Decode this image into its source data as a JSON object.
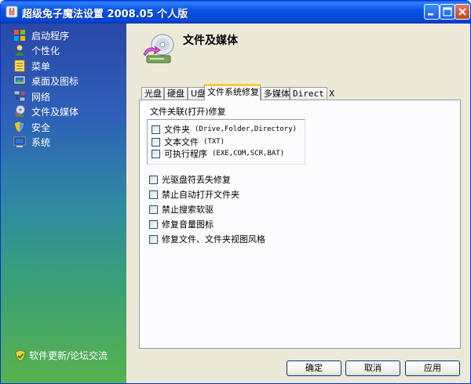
{
  "window": {
    "title": "超级兔子魔法设置 2008.05 个人版"
  },
  "sidebar": {
    "items": [
      {
        "label": "启动程序",
        "icon": "startup-icon"
      },
      {
        "label": "个性化",
        "icon": "personalize-icon"
      },
      {
        "label": "菜单",
        "icon": "menu-icon"
      },
      {
        "label": "桌面及图标",
        "icon": "desktop-icon"
      },
      {
        "label": "网络",
        "icon": "network-icon"
      },
      {
        "label": "文件及媒体",
        "icon": "file-media-icon"
      },
      {
        "label": "安全",
        "icon": "security-icon"
      },
      {
        "label": "系统",
        "icon": "system-icon"
      }
    ],
    "update_link": "软件更新/论坛交流"
  },
  "page": {
    "title": "文件及媒体"
  },
  "tabs": [
    {
      "label": "光盘"
    },
    {
      "label": "硬盘"
    },
    {
      "label": "U盘"
    },
    {
      "label": "文件系统修复",
      "active": true
    },
    {
      "label": "多媒体"
    },
    {
      "label": "Direct X"
    }
  ],
  "panel": {
    "section_label": "文件关联(打开)修复",
    "associations": [
      {
        "label": "文件夹",
        "detail": "(Drive,Folder,Directory)",
        "checked": false
      },
      {
        "label": "文本文件",
        "detail": "(TXT)",
        "checked": false
      },
      {
        "label": "可执行程序",
        "detail": "(EXE,COM,SCR,BAT)",
        "checked": false
      }
    ],
    "options": [
      {
        "label": "光驱盘符丢失修复",
        "checked": false
      },
      {
        "label": "禁止自动打开文件夹",
        "checked": false
      },
      {
        "label": "禁止搜索软驱",
        "checked": false
      },
      {
        "label": "修复音量图标",
        "checked": false
      },
      {
        "label": "修复文件、文件夹视图风格",
        "checked": false
      }
    ]
  },
  "buttons": {
    "ok": "确定",
    "cancel": "取消",
    "apply": "应用"
  }
}
